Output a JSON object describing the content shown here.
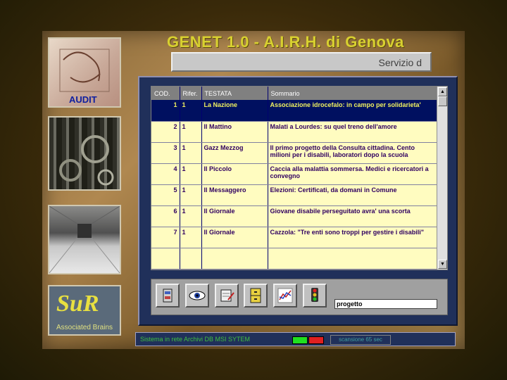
{
  "app": {
    "title": "GENET 1.0 - A.I.R.H. di Genova",
    "service_label": "Servizio d"
  },
  "sidebar": {
    "audit_label": "AUDIT",
    "logo_mark": "SuR",
    "logo_label": "Associated Brains"
  },
  "table": {
    "headers": [
      "COD.",
      "Rifer.",
      "TESTATA",
      "Sommario"
    ],
    "rows": [
      {
        "cod": "1",
        "rifer": "1",
        "testata": "La Nazione",
        "sommario": "Associazione idrocefalo: in campo per solidarieta'"
      },
      {
        "cod": "2",
        "rifer": "1",
        "testata": "Il Mattino",
        "sommario": "Malati a Lourdes: su quel treno dell'amore"
      },
      {
        "cod": "3",
        "rifer": "1",
        "testata": "Gazz Mezzog",
        "sommario": "Il primo progetto della Consulta cittadina. Cento milioni per i disabili, laboratori dopo la scuola"
      },
      {
        "cod": "4",
        "rifer": "1",
        "testata": "Il Piccolo",
        "sommario": "Caccia alla malattia sommersa. Medici e ricercatori a convegno"
      },
      {
        "cod": "5",
        "rifer": "1",
        "testata": "Il Messaggero",
        "sommario": "Elezioni: Certificati, da domani in Comune"
      },
      {
        "cod": "6",
        "rifer": "1",
        "testata": "Il Giornale",
        "sommario": "Giovane disabile perseguitato avra' una scorta"
      },
      {
        "cod": "7",
        "rifer": "1",
        "testata": "Il Giornale",
        "sommario": "Cazzola: \"Tre enti sono troppi per gestire i disabili\""
      },
      {
        "cod": "",
        "rifer": "",
        "testata": "",
        "sommario": ""
      }
    ],
    "selected_row": 0
  },
  "toolbar": {
    "icons": [
      "cabinet-icon",
      "eye-icon",
      "notepad-icon",
      "drawers-icon",
      "chart-icon",
      "traffic-light-icon"
    ],
    "search_value": "progetto"
  },
  "status": {
    "text": "Sistema in rete Archivi DB MSI SYTEM",
    "scan_label": "scansione 65 sec"
  },
  "colors": {
    "title": "#d8d030",
    "selected_row_bg": "#001060",
    "grid_bg": "#fffcc0",
    "led_green": "#20e020",
    "led_red": "#e02020"
  }
}
